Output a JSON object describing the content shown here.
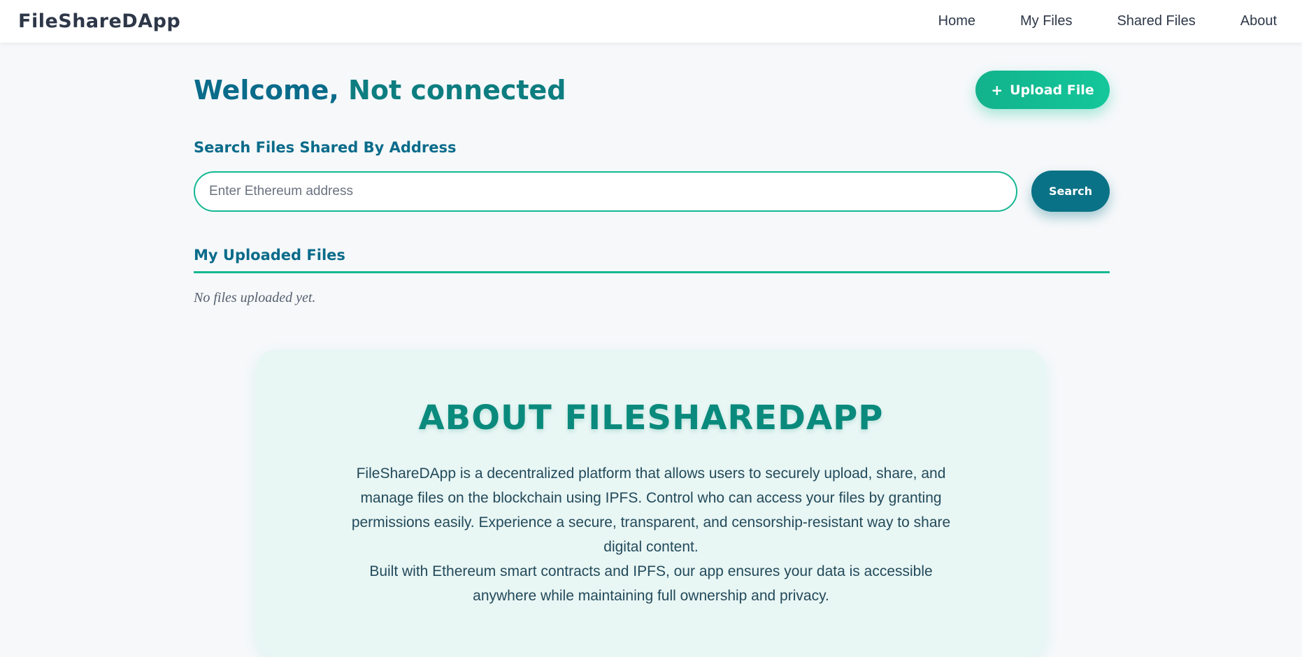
{
  "nav": {
    "brand": "FileShareDApp",
    "links": [
      "Home",
      "My Files",
      "Shared Files",
      "About"
    ]
  },
  "welcome": {
    "prefix": "Welcome,",
    "status": "Not connected"
  },
  "upload": {
    "icon": "plus-icon",
    "label": "Upload File"
  },
  "search": {
    "title": "Search Files Shared By Address",
    "placeholder": "Enter Ethereum address",
    "value": "",
    "button_label": "Search"
  },
  "files": {
    "title": "My Uploaded Files",
    "empty_message": "No files uploaded yet."
  },
  "about": {
    "title": "ABOUT FILESHAREDAPP",
    "paragraph1": "FileShareDApp is a decentralized platform that allows users to securely upload, share, and manage files on the blockchain using IPFS. Control who can access your files by granting permissions easily. Experience a secure, transparent, and censorship-resistant way to share digital content.",
    "paragraph2": "Built with Ethereum smart contracts and IPFS, our app ensures your data is accessible anywhere while maintaining full ownership and privacy."
  },
  "colors": {
    "primary": "#0a6b8a",
    "accent": "#14b892",
    "search_button": "#0a7286",
    "about_bg": "#e8f6f4"
  }
}
